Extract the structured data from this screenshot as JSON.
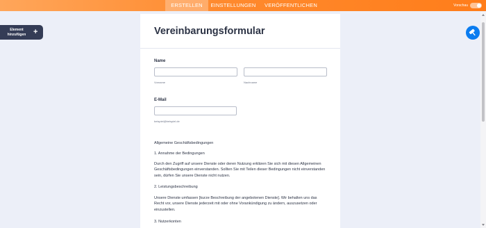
{
  "topbar": {
    "tabs": [
      {
        "label": "ERSTELLEN",
        "active": true
      },
      {
        "label": "EINSTELLUNGEN",
        "active": false
      },
      {
        "label": "VERÖFFENTLICHEN",
        "active": false
      }
    ],
    "preview_label": "Vorschau",
    "preview_enabled": false,
    "accent_color": "#ff8a2e"
  },
  "sidebar": {
    "add_element_label": "Element hinzufügen",
    "add_icon": "plus-icon"
  },
  "form": {
    "title": "Vereinbarungsformular",
    "name_field": {
      "label": "Name",
      "first_sublabel": "Vorname",
      "last_sublabel": "Nachname",
      "first_value": "",
      "last_value": ""
    },
    "email_field": {
      "label": "E-Mail",
      "sublabel": "beispiel@beispiel.de",
      "value": ""
    },
    "terms": {
      "heading": "Allgemeine Geschäftsbedingungen",
      "section1_title": "1. Annahme der Bedingungen",
      "section1_body": "Durch den Zugriff auf unsere Dienste oder deren Nutzung erklären Sie sich mit diesen Allgemeinen Geschäftsbedingungen einverstanden. Sollten Sie mit Teilen dieser Bedingungen nicht einverstanden sein, dürfen Sie unsere Dienste nicht nutzen.",
      "section2_title": "2. Leistungsbeschreibung",
      "section2_body": "Unsere Dienste umfassen [kurze Beschreibung der angebotenen Dienste]. Wir behalten uns das Recht vor, unsere Dienste jederzeit mit oder ohne Vorankündigung zu ändern, auszusetzen oder einzustellen.",
      "section3_title": "3. Nutzerkonten"
    }
  },
  "fab": {
    "icon": "paint-roller-icon",
    "color": "#0a7cf0"
  }
}
